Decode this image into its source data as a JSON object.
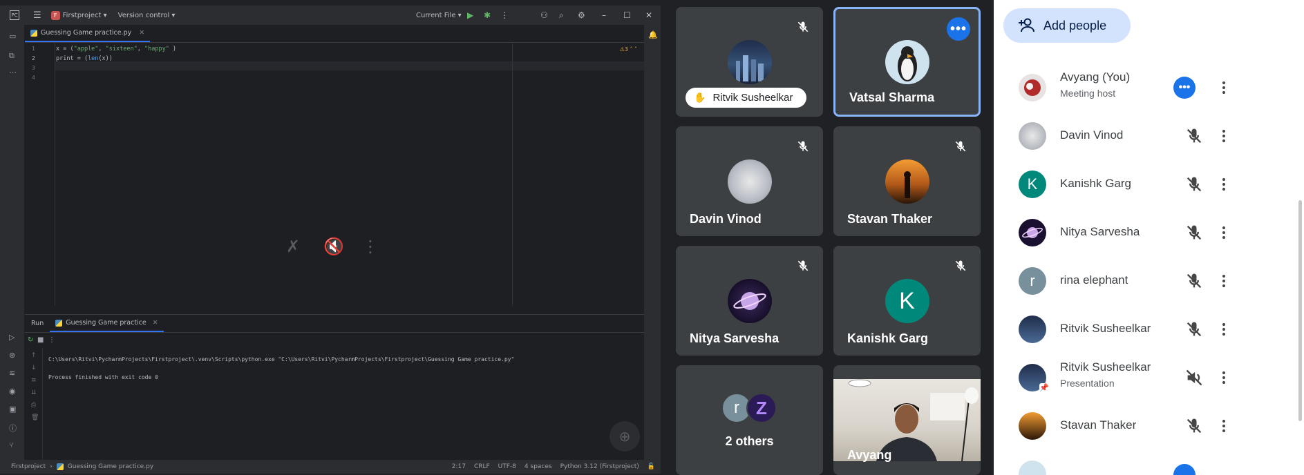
{
  "ide": {
    "project": "Firstproject",
    "project_badge": "F",
    "version_control": "Version control",
    "run_config": "Current File",
    "file_tab": "Guessing Game practice.py",
    "warning_count": "3",
    "line_numbers": [
      "1",
      "2",
      "3",
      "4"
    ],
    "code_line1_prefix": "x = (",
    "code_line1_s1": "\"apple\"",
    "code_line1_sep1": ", ",
    "code_line1_s2": "\"sixteen\"",
    "code_line1_sep2": ", ",
    "code_line1_s3": "\"happy\"",
    "code_line1_suffix": " )",
    "code_line2_prefix": "print = (",
    "code_line2_fn": "len",
    "code_line2_suffix": "(x))",
    "run_label": "Run",
    "run_tab": "Guessing Game practice",
    "output_cmd": "C:\\Users\\Ritvi\\PycharmProjects\\Firstproject\\.venv\\Scripts\\python.exe \"C:\\Users\\Ritvi\\PycharmProjects\\Firstproject\\Guessing Game practice.py\"",
    "output_exit": "Process finished with exit code 0",
    "status_project": "Firstproject",
    "status_file": "Guessing Game practice.py",
    "status_pos": "2:17",
    "status_eol": "CRLF",
    "status_enc": "UTF-8",
    "status_indent": "4 spaces",
    "status_interp": "Python 3.12 (Firstproject)"
  },
  "tiles": {
    "ritvik_pill": "Ritvik Susheelkar",
    "vatsal": "Vatsal Sharma",
    "davin": "Davin Vinod",
    "stavan": "Stavan Thaker",
    "nitya": "Nitya Sarvesha",
    "kanishk": "Kanishk Garg",
    "kanishk_letter": "K",
    "others": "2 others",
    "others_r": "r",
    "others_z": "Z",
    "avyang": "Avyang"
  },
  "panel": {
    "add_people": "Add people",
    "people": [
      {
        "name": "Avyang (You)",
        "sub": "Meeting host"
      },
      {
        "name": "Davin Vinod",
        "sub": ""
      },
      {
        "name": "Kanishk Garg",
        "sub": "",
        "letter": "K"
      },
      {
        "name": "Nitya Sarvesha",
        "sub": ""
      },
      {
        "name": "rina elephant",
        "sub": "",
        "letter": "r"
      },
      {
        "name": "Ritvik Susheelkar",
        "sub": ""
      },
      {
        "name": "Ritvik Susheelkar",
        "sub": "Presentation"
      },
      {
        "name": "Stavan Thaker",
        "sub": ""
      }
    ]
  },
  "colors": {
    "meet_bg": "#202124",
    "tile_bg": "#3c4043",
    "accent_blue": "#1a73e8",
    "active_border": "#8ab4f8",
    "kanishk_teal": "#00897b",
    "add_btn_bg": "#d3e3fd"
  }
}
